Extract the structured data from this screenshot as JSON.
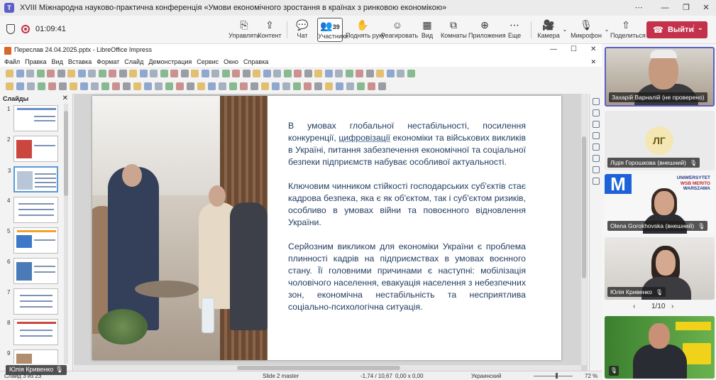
{
  "window": {
    "title": "XVIII Міжнародна науково-практична конференція «Умови економічного зростання в країнах з ринковою економікою»",
    "controls": [
      "⋯",
      "—",
      "❐",
      "✕"
    ]
  },
  "meeting": {
    "timer": "01:09:41",
    "tools": [
      {
        "icon": "⎘",
        "label": "Управлять"
      },
      {
        "icon": "⇪",
        "label": "Контент"
      },
      {
        "icon": "💬",
        "label": "Чат"
      },
      {
        "icon": "👥",
        "label": "Участники",
        "count": "39"
      },
      {
        "icon": "✋",
        "label": "Поднять руку"
      },
      {
        "icon": "☺",
        "label": "Реагировать"
      },
      {
        "icon": "▦",
        "label": "Вид"
      },
      {
        "icon": "⧉",
        "label": "Комнаты"
      },
      {
        "icon": "⊕",
        "label": "Приложения"
      },
      {
        "icon": "⋯",
        "label": "Еще"
      },
      {
        "icon": "🎥",
        "label": "Камера"
      },
      {
        "icon": "🎙",
        "label": "Микрофон"
      },
      {
        "icon": "⇧",
        "label": "Поделиться"
      }
    ],
    "leave_label": "Выйти"
  },
  "impress": {
    "title": "Переслав 24.04.2025.pptx - LibreOffice Impress",
    "menu": [
      "Файл",
      "Правка",
      "Вид",
      "Вставка",
      "Формат",
      "Слайд",
      "Демонстрация",
      "Сервис",
      "Окно",
      "Справка"
    ],
    "slides_panel_title": "Слайды",
    "slide_numbers": [
      "1",
      "2",
      "3",
      "4",
      "5",
      "6",
      "7",
      "8",
      "9"
    ],
    "selected_slide": 3,
    "slide_text": {
      "p1_a": "В умовах глобальної нестабільності, посилення конкуренції, ",
      "p1_u": "цифровізації",
      "p1_b": " економіки та військових викликів в Україні, питання забезпечення економічної та соціальної безпеки підприємств набуває особливої актуальності.",
      "p2": "Ключовим чинником стійкості господарських суб'єктів стає кадрова безпека, яка є як об'єктом, так і суб'єктом ризиків, особливо в умовах війни та повоєнного відновлення України.",
      "p3": "Серйозним викликом для економіки України є проблема плинності кадрів на підприємствах в умовах воєнного стану. Її головними причинами є наступні: мобілізація чоловічого населення, евакуація населення з небезпечних зон, економічна нестабільність та несприятлива соціально-психологічна ситуація."
    },
    "status": {
      "slide_info": "Слайд 3 из 23",
      "master": "Slide 2 master",
      "position": "-1,74 / 10,67",
      "size": "0,00 x 0,00",
      "language": "Украинский",
      "zoom": "72 %"
    }
  },
  "overlay_name": "Юлія Кривенко",
  "participants": [
    {
      "name": "Захарій Варналій (не проверено)"
    },
    {
      "name": "Лідія Горошкова (внешний)",
      "initials": "ЛГ"
    },
    {
      "name": "Olena Gorokhovska (внешний)",
      "logo_lines": [
        "UNIWERSYTET",
        "WSB MERITO",
        "WARSZAWA"
      ]
    },
    {
      "name": "Юлія Кривенко"
    }
  ],
  "pager": {
    "text": "1/10",
    "prev": "‹",
    "next": "›"
  }
}
